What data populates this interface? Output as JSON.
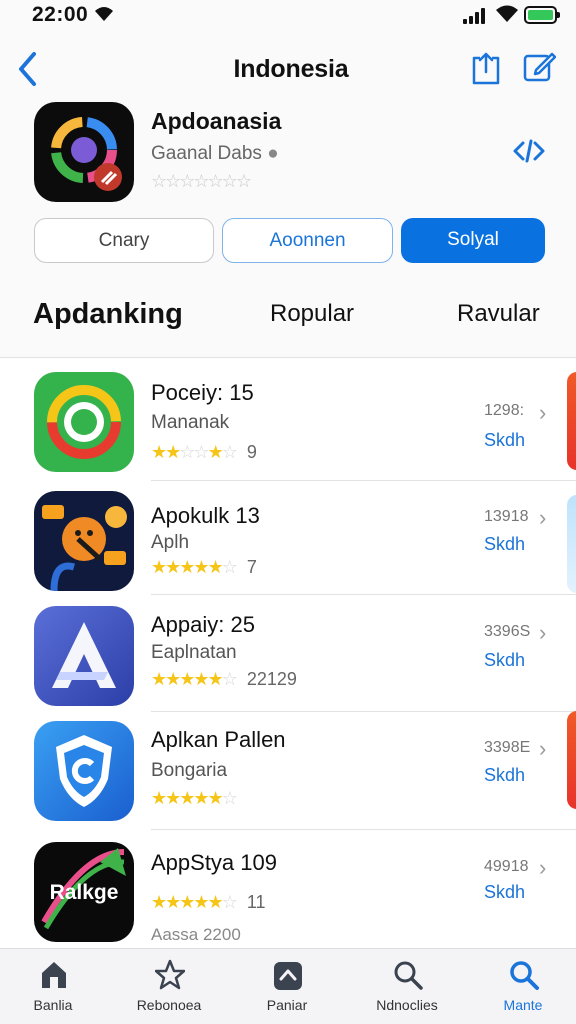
{
  "status_bar": {
    "time": "22:00"
  },
  "nav": {
    "title": "Indonesia"
  },
  "featured": {
    "name": "Apdoanasia",
    "developer": "Gaanal Dabs",
    "rating_stars": 0,
    "buttons": [
      "Cnary",
      "Aoonnen",
      "Solyal"
    ]
  },
  "tabs": [
    "Apdanking",
    "Ropular",
    "Ravular"
  ],
  "apps": [
    {
      "title": "Poceiy: 15",
      "subtitle": "Mananak",
      "stars": 3,
      "rating_count": "9",
      "size": "1298:",
      "action": "Skdh"
    },
    {
      "title": "Apokulk 13",
      "subtitle": "Aplh",
      "stars": 5,
      "rating_count": "7",
      "size": "13918",
      "action": "Skdh"
    },
    {
      "title": "Appaiy: 25",
      "subtitle": "Eaplnatan",
      "stars": 4.5,
      "rating_count": "22129",
      "size": "3396S",
      "action": "Skdh"
    },
    {
      "title": "Aplkan Pallen",
      "subtitle": "Bongaria",
      "stars": 5,
      "rating_count": "",
      "size": "3398E",
      "action": "Skdh"
    },
    {
      "title": "AppStya 109",
      "subtitle": "",
      "stars": 5,
      "rating_count": "11",
      "size": "49918",
      "action": "Skdh",
      "extra": "Aassa 2200"
    }
  ],
  "bottom_tabs": [
    {
      "label": "Banlia",
      "icon": "home-icon"
    },
    {
      "label": "Rebonoea",
      "icon": "star-icon"
    },
    {
      "label": "Paniar",
      "icon": "layers-icon"
    },
    {
      "label": "Ndnoclies",
      "icon": "search-icon"
    },
    {
      "label": "Mante",
      "icon": "search-active-icon",
      "active": true
    }
  ]
}
